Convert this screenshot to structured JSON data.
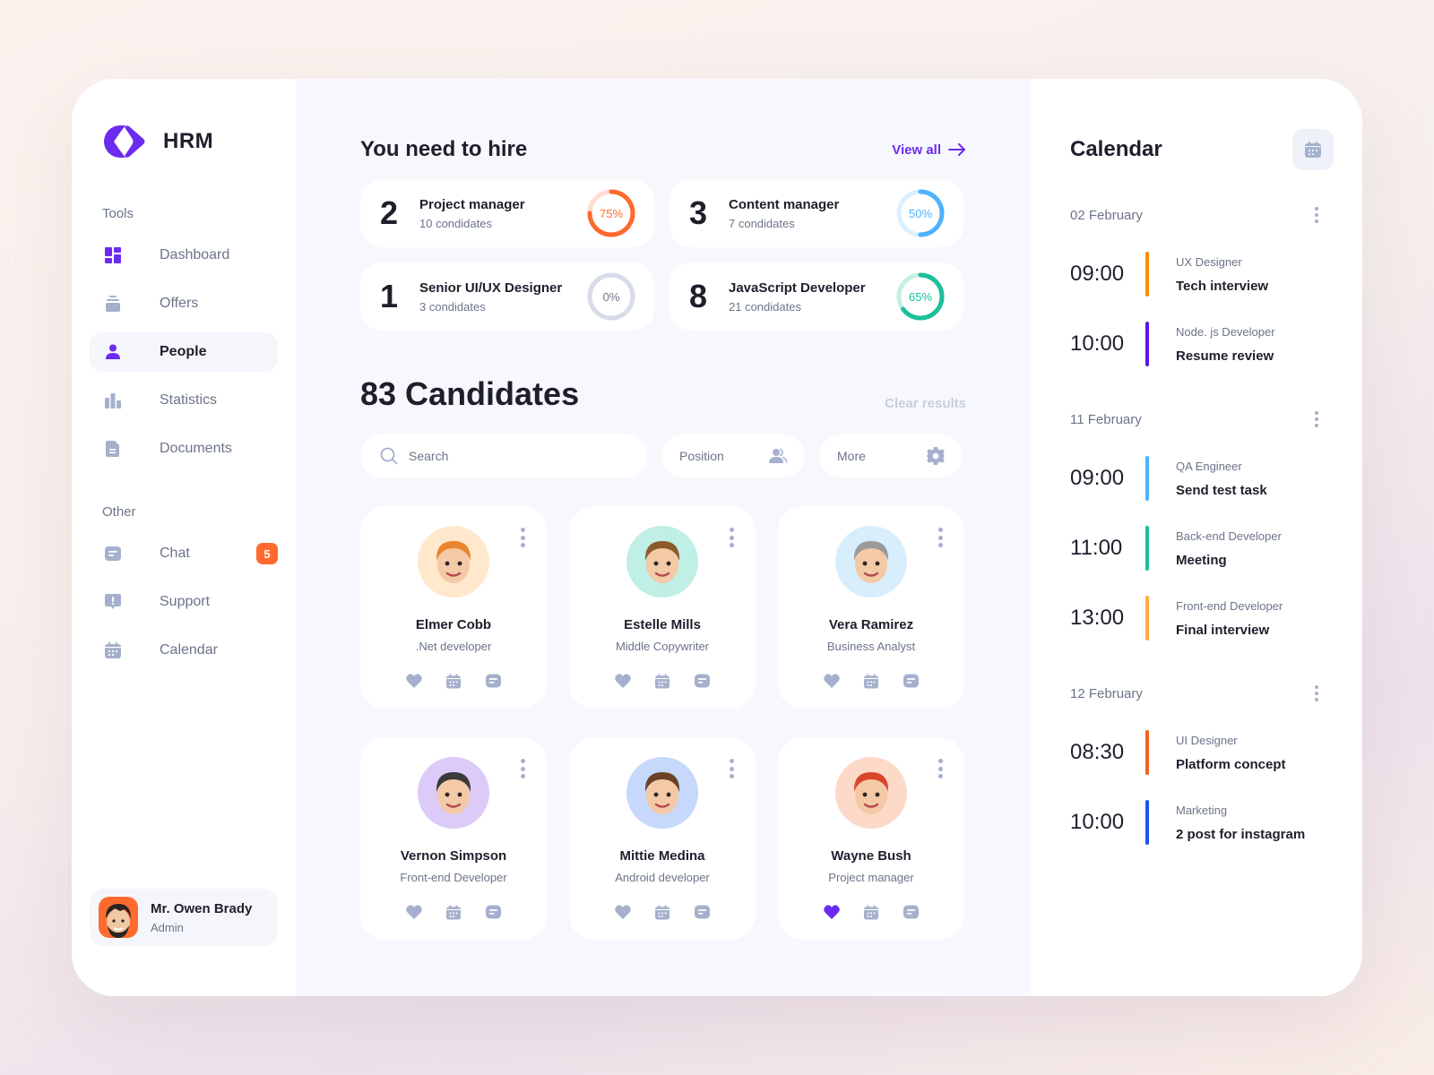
{
  "app": {
    "logo_text": "HRM",
    "brand_color": "#6c2bf0"
  },
  "sidebar": {
    "tools_label": "Tools",
    "tools": [
      {
        "label": "Dashboard",
        "icon": "dashboard-icon",
        "active": false
      },
      {
        "label": "Offers",
        "icon": "offers-icon",
        "active": false
      },
      {
        "label": "People",
        "icon": "people-icon",
        "active": true
      },
      {
        "label": "Statistics",
        "icon": "statistics-icon",
        "active": false
      },
      {
        "label": "Documents",
        "icon": "documents-icon",
        "active": false
      }
    ],
    "other_label": "Other",
    "other": [
      {
        "label": "Chat",
        "icon": "chat-icon",
        "badge": "5"
      },
      {
        "label": "Support",
        "icon": "support-icon"
      },
      {
        "label": "Calendar",
        "icon": "calendar-icon"
      }
    ],
    "profile": {
      "name": "Mr. Owen Brady",
      "role": "Admin"
    }
  },
  "hire": {
    "title": "You need to hire",
    "view_all": "View all",
    "items": [
      {
        "count": "2",
        "title": "Project manager",
        "candidates": "10 condidates",
        "percent": 75,
        "percent_label": "75%",
        "color": "#ff6a2e",
        "track": "#ffdccf"
      },
      {
        "count": "3",
        "title": "Content manager",
        "candidates": "7 condidates",
        "percent": 50,
        "percent_label": "50%",
        "color": "#4db2ff",
        "track": "#dcefff"
      },
      {
        "count": "1",
        "title": "Senior UI/UX Designer",
        "candidates": "3 condidates",
        "percent": 0,
        "percent_label": "0%",
        "color": "#6b7488",
        "track": "#d6dce8"
      },
      {
        "count": "8",
        "title": "JavaScript Developer",
        "candidates": "21 condidates",
        "percent": 65,
        "percent_label": "65%",
        "color": "#1dbf9a",
        "track": "#c6f0e4"
      }
    ]
  },
  "candidates": {
    "title": "83 Candidates",
    "clear_results": "Clear results",
    "search_placeholder": "Search",
    "position_label": "Position",
    "more_label": "More",
    "items": [
      {
        "name": "Elmer Cobb",
        "role": ".Net developer",
        "avatar_bg": "#ffe8cc",
        "liked": false
      },
      {
        "name": "Estelle Mills",
        "role": "Middle Copywriter",
        "avatar_bg": "#bfefe5",
        "liked": false
      },
      {
        "name": "Vera Ramirez",
        "role": "Business Analyst",
        "avatar_bg": "#d8eefc",
        "liked": false
      },
      {
        "name": "Vernon Simpson",
        "role": "Front-end Developer",
        "avatar_bg": "#dccbf8",
        "liked": false
      },
      {
        "name": "Mittie Medina",
        "role": "Android developer",
        "avatar_bg": "#c6d8fb",
        "liked": false
      },
      {
        "name": "Wayne Bush",
        "role": "Project manager",
        "avatar_bg": "#fdd9c8",
        "liked": true
      }
    ]
  },
  "calendar": {
    "title": "Calendar",
    "days": [
      {
        "date": "02 February",
        "events": [
          {
            "time": "09:00",
            "role": "UX Designer",
            "title": "Tech interview",
            "color": "#ff8c00"
          },
          {
            "time": "10:00",
            "role": "Node. js Developer",
            "title": "Resume review",
            "color": "#5a16e8"
          }
        ]
      },
      {
        "date": "11 February",
        "events": [
          {
            "time": "09:00",
            "role": "QA Engineer",
            "title": "Send test task",
            "color": "#4db2ff"
          },
          {
            "time": "11:00",
            "role": "Back-end Developer",
            "title": "Meeting",
            "color": "#1dbf9a"
          },
          {
            "time": "13:00",
            "role": "Front-end Developer",
            "title": "Final interview",
            "color": "#ffab40"
          }
        ]
      },
      {
        "date": "12 February",
        "events": [
          {
            "time": "08:30",
            "role": "UI Designer",
            "title": "Platform concept",
            "color": "#f2621e"
          },
          {
            "time": "10:00",
            "role": "Marketing",
            "title": "2 post for instagram",
            "color": "#1f55f0"
          }
        ]
      }
    ]
  }
}
